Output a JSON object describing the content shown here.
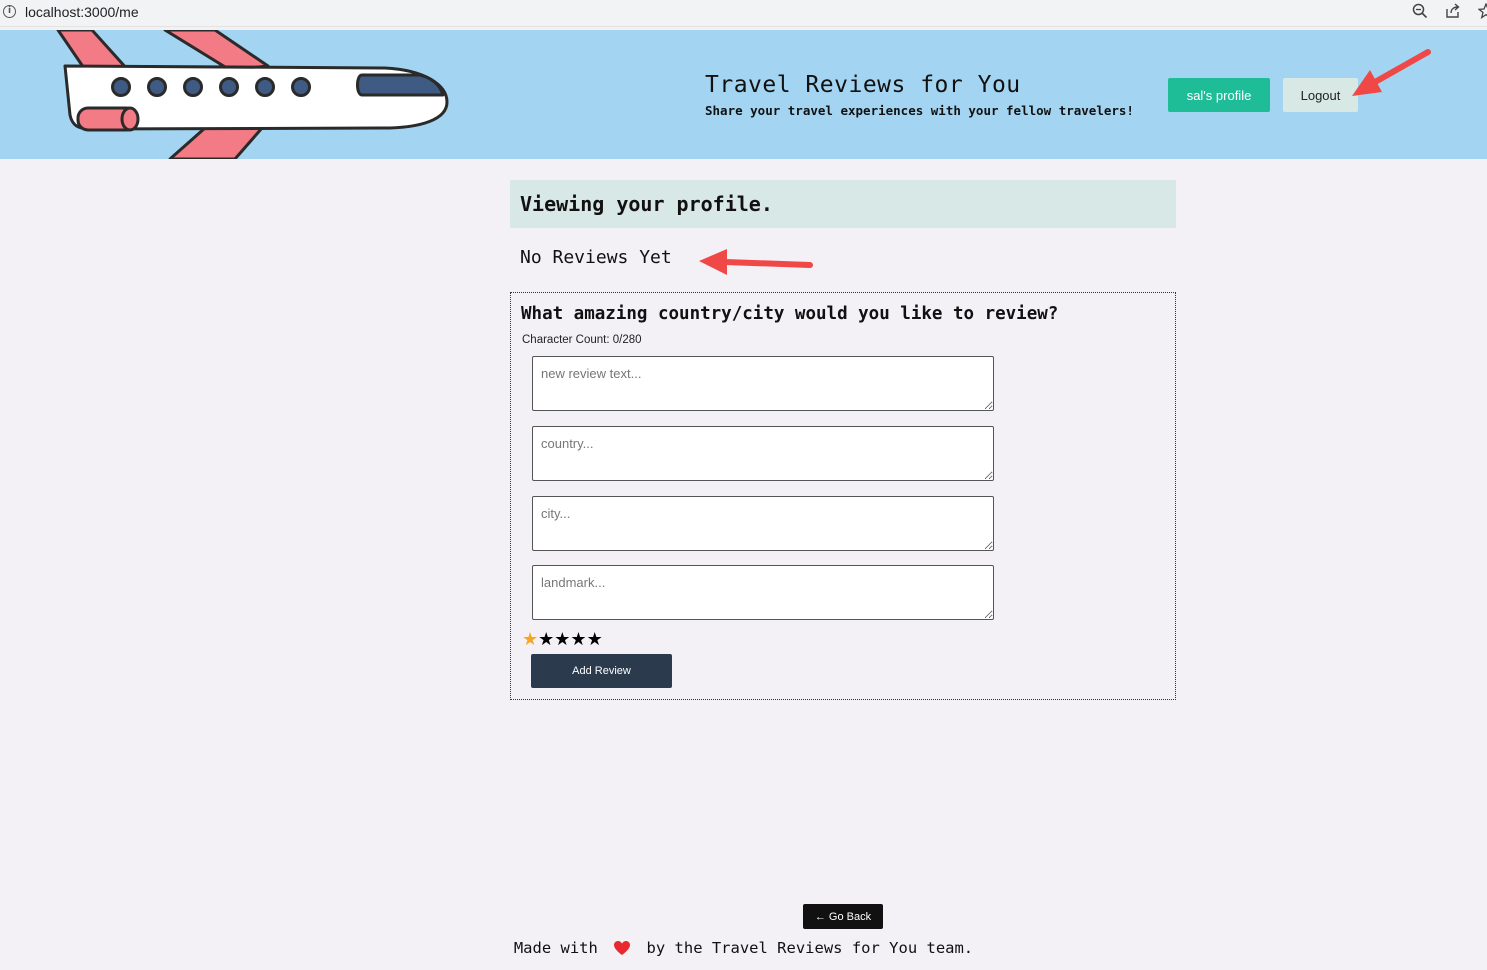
{
  "browser": {
    "url": "localhost:3000/me"
  },
  "header": {
    "title": "Travel Reviews for You",
    "subtitle": "Share your travel experiences with your fellow travelers!",
    "profile_button": "sal's profile",
    "logout_button": "Logout"
  },
  "main": {
    "profile_heading": "Viewing your profile.",
    "no_reviews": "No Reviews Yet",
    "form": {
      "question": "What amazing country/city would you like to review?",
      "char_count": "Character Count: 0/280",
      "review_placeholder": "new review text...",
      "country_placeholder": "country...",
      "city_placeholder": "city...",
      "landmark_placeholder": "landmark...",
      "rating": 1,
      "rating_max": 5,
      "stars": [
        "★",
        "★",
        "★",
        "★",
        "★"
      ],
      "add_button": "Add Review"
    }
  },
  "nav": {
    "back_button": "← Go Back"
  },
  "footer": {
    "text_before": "Made with",
    "text_after": "by the Travel Reviews for You team."
  },
  "colors": {
    "header_bg": "#a3d5f2",
    "profile_button": "#1fbd97",
    "logout_button": "#d8e8e4",
    "add_button": "#2b3a4c",
    "star_active": "#f5a623",
    "annotation_arrow": "#f04747",
    "heart": "#e8292f"
  }
}
